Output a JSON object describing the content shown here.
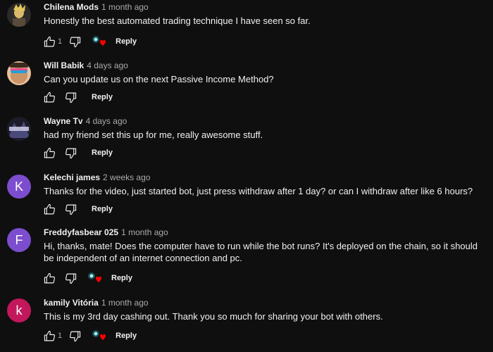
{
  "comments": [
    {
      "author": "Chilena Mods",
      "time": "1 month ago",
      "text": "Honestly the best automated trading technique I have seen so far.",
      "likes": "1",
      "avatar_letter": "",
      "avatar_color": "#2a2a2a",
      "has_heart": true,
      "reply": "Reply"
    },
    {
      "author": "Will Babik",
      "time": "4 days ago",
      "text": "Can you update us on the next Passive Income Method?",
      "likes": "",
      "avatar_letter": "",
      "avatar_color": "#b98a6a",
      "has_heart": false,
      "reply": "Reply"
    },
    {
      "author": "Wayne Tv",
      "time": "4 days ago",
      "text": "had my friend set this up for me, really awesome stuff.",
      "likes": "",
      "avatar_letter": "",
      "avatar_color": "#1c1c2a",
      "has_heart": false,
      "reply": "Reply"
    },
    {
      "author": "Kelechi james",
      "time": "2 weeks ago",
      "text": "Thanks for the video, just started bot, just press withdraw after 1 day? or can I withdraw after like 6 hours?",
      "likes": "",
      "avatar_letter": "K",
      "avatar_color": "#7c4dcf",
      "has_heart": false,
      "reply": "Reply"
    },
    {
      "author": "Freddyfasbear 025",
      "time": "1 month ago",
      "text": "Hi, thanks, mate! Does the computer have to run while the bot runs? It's deployed on the chain, so it should be independent of an internet connection and pc.",
      "likes": "",
      "avatar_letter": "F",
      "avatar_color": "#7c4dcf",
      "has_heart": true,
      "reply": "Reply"
    },
    {
      "author": "kamily Vitória",
      "time": "1 month ago",
      "text": "This is my 3rd day cashing out. Thank you so much for sharing your bot with others.",
      "likes": "1",
      "avatar_letter": "k",
      "avatar_color": "#c2185b",
      "has_heart": true,
      "reply": "Reply"
    }
  ]
}
